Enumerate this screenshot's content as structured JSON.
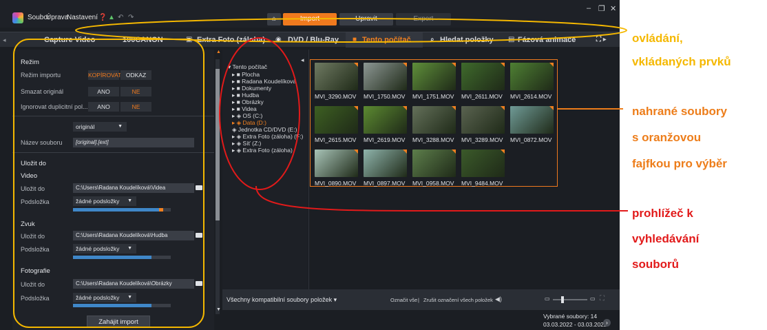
{
  "menu": {
    "file": "Soubor",
    "edit": "Úprava",
    "settings": "Nastavení"
  },
  "topbar": {
    "import": "Import",
    "edit": "Upravit",
    "export": "Export"
  },
  "tabs": [
    {
      "label": "Capture Video"
    },
    {
      "label": "100CANON"
    },
    {
      "label": "Extra Foto (záloha)"
    },
    {
      "label": "DVD / Blu-Ray"
    },
    {
      "label": "Tento počítač"
    },
    {
      "label": "Hledat položky"
    },
    {
      "label": "Fázová animace"
    }
  ],
  "left": {
    "mode_heading": "Režim",
    "import_mode_label": "Režim importu",
    "copy": "KOPÍROVAT",
    "link": "ODKAZ",
    "delete_original_label": "Smazat originál",
    "yes": "ANO",
    "no": "NE",
    "ignore_dup_label": "Ignorovat duplicitní pol...",
    "yes2": "ANO",
    "no2": "NE",
    "name_mode": "originál",
    "filename_label": "Název souboru",
    "filename_value": "[original].[ext]",
    "save_heading": "Uložit do",
    "video_heading": "Video",
    "save_to_label": "Uložit do",
    "video_path": "C:\\Users\\Radana Koudelíková\\Videa",
    "subfolder_label": "Podsložka",
    "subfolder_value": "žádné podsložky",
    "audio_heading": "Zvuk",
    "audio_path": "C:\\Users\\Radana Koudelíková\\Hudba",
    "photo_heading": "Fotografie",
    "photo_path": "C:\\Users\\Radana Koudelíková\\Obrázky",
    "start_import": "Zahájit import",
    "video_fill": 0.9,
    "audio_fill": 0.8,
    "photo_fill": 0.8
  },
  "tree": [
    {
      "label": "Tento počítač"
    },
    {
      "label": "Plocha"
    },
    {
      "label": "Radana Koudelíková"
    },
    {
      "label": "Dokumenty"
    },
    {
      "label": "Hudba"
    },
    {
      "label": "Obrázky"
    },
    {
      "label": "Videa"
    },
    {
      "label": "OS (C:)"
    },
    {
      "label": "Data (D:)"
    },
    {
      "label": "Jednotka CD/DVD (E:)"
    },
    {
      "label": "Extra Foto (záloha) (F:)"
    },
    {
      "label": "Síť (Z:)"
    },
    {
      "label": "Extra Foto (záloha)"
    }
  ],
  "files": [
    {
      "name": "MVI_3290.MOV",
      "color": "#6f7a62"
    },
    {
      "name": "MVI_1750.MOV",
      "color": "#8d9794"
    },
    {
      "name": "MVI_1751.MOV",
      "color": "#5f8f3a"
    },
    {
      "name": "MVI_2611.MOV",
      "color": "#3f6a2c"
    },
    {
      "name": "MVI_2614.MOV",
      "color": "#4e7f33"
    },
    {
      "name": "MVI_2615.MOV",
      "color": "#3d5f22"
    },
    {
      "name": "MVI_2619.MOV",
      "color": "#5c8a31"
    },
    {
      "name": "MVI_3288.MOV",
      "color": "#64705a"
    },
    {
      "name": "MVI_3289.MOV",
      "color": "#5a6350"
    },
    {
      "name": "MVI_0872.MOV",
      "color": "#6f9a96"
    },
    {
      "name": "MVI_0890.MOV",
      "color": "#a8c4b8"
    },
    {
      "name": "MVI_0897.MOV",
      "color": "#8fb4ac"
    },
    {
      "name": "MVI_0958.MOV",
      "color": "#5d7e4b"
    },
    {
      "name": "MVI_9484.MOV",
      "color": "#3b5a2a"
    }
  ],
  "bottom": {
    "filter": "Všechny kompatibilní soubory položek",
    "mark_all": "Označit vše",
    "sep": "|",
    "unmark_all": "Zrušit označení všech položek",
    "selected": "Vybrané soubory: 14",
    "date_range": "03.03.2022 - 03.03.2022"
  },
  "annotations": {
    "a1_line1": "ovládání,",
    "a1_line2": "vkládaných prvků",
    "a2_line1": "nahrané soubory",
    "a2_line2": "s oranžovou",
    "a2_line3": "fajfkou pro výběr",
    "a3_line1": "prohlížeč k",
    "a3_line2": "vyhledávání",
    "a3_line3": "souborů",
    "color_yellow": "#f5b800",
    "color_orange": "#ed7d1a",
    "color_red": "#e21a1a"
  }
}
